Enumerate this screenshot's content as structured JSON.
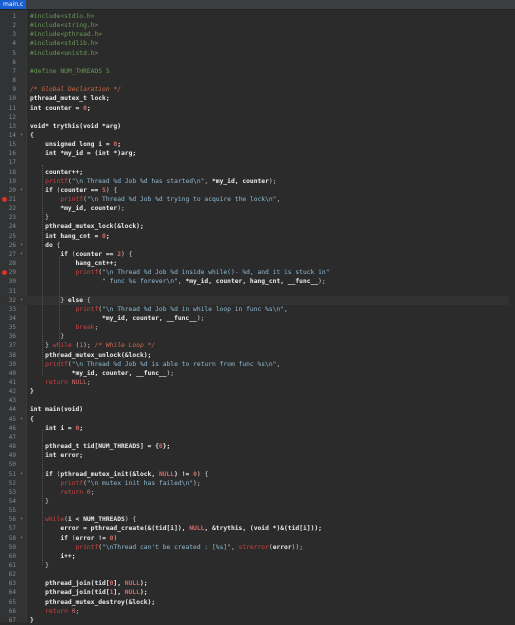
{
  "window": {
    "tab_label": "main.c"
  },
  "colors": {
    "background": "#2b2b2b",
    "gutter": "#313335",
    "tab_active": "#1a5fd1",
    "preprocessor": "#6a9955",
    "comment": "#cf6a4c",
    "string": "#8fbcd4",
    "function_call": "#d04040",
    "breakpoint": "#d9342b"
  },
  "editor": {
    "lines": [
      {
        "n": "1",
        "html": "<span class='pp'>#include&lt;stdio.h&gt;</span>"
      },
      {
        "n": "2",
        "html": "<span class='pp'>#include&lt;string.h&gt;</span>"
      },
      {
        "n": "3",
        "html": "<span class='pp'>#include&lt;pthread.h&gt;</span>"
      },
      {
        "n": "4",
        "html": "<span class='pp'>#include&lt;stdlib.h&gt;</span>"
      },
      {
        "n": "5",
        "html": "<span class='pp'>#include&lt;unistd.h&gt;</span>"
      },
      {
        "n": "6",
        "html": ""
      },
      {
        "n": "7",
        "html": "<span class='pp'>#define NUM_THREADS 5</span>"
      },
      {
        "n": "8",
        "html": ""
      },
      {
        "n": "9",
        "html": "<span class='cm'>/* Global Declaration */</span>"
      },
      {
        "n": "10",
        "html": "<span class='id'>pthread_mutex_t lock;</span>"
      },
      {
        "n": "11",
        "html": "<span class='id'>int counter = <span class='num'>0</span>;</span>"
      },
      {
        "n": "12",
        "html": ""
      },
      {
        "n": "13",
        "html": "<span class='id'>void* trythis(void *arg)</span>"
      },
      {
        "n": "14",
        "html": "<span class='id'>{</span>",
        "fold": "▾"
      },
      {
        "n": "15",
        "html": "    <span class='id'>unsigned long i = <span class='num'>0</span>;</span>"
      },
      {
        "n": "16",
        "html": "    <span class='id'>int *my_id = (int *)arg;</span>"
      },
      {
        "n": "17",
        "html": ""
      },
      {
        "n": "18",
        "html": "    <span class='id'>counter++;</span>"
      },
      {
        "n": "19",
        "html": "    <span class='fn'>printf</span>(<span class='str'>\"\\n Thread %d Job %d has started\\n\"</span>, <span class='id'>*my_id, counter</span>);"
      },
      {
        "n": "20",
        "html": "    <span class='kw'>if</span> (<span class='id'>counter == <span class='num'>5</span></span>) {",
        "fold": "▾"
      },
      {
        "n": "21",
        "html": "        <span class='fn'>printf</span>(<span class='str'>\"\\n Thread %d Job %d trying to acquire the lock\\n\"</span>,",
        "bp": true
      },
      {
        "n": "22",
        "html": "        <span class='id'>*my_id, counter</span>);"
      },
      {
        "n": "23",
        "html": "    }"
      },
      {
        "n": "24",
        "html": "    <span class='id'>pthread_mutex_lock(&amp;lock);</span>"
      },
      {
        "n": "25",
        "html": "    <span class='id'>int hang_cnt = <span class='num'>0</span>;</span>"
      },
      {
        "n": "26",
        "html": "    <span class='kw'>do</span> {",
        "fold": "▾"
      },
      {
        "n": "27",
        "html": "        <span class='kw'>if</span> (<span class='id'>counter == <span class='num'>2</span></span>) {",
        "fold": "▾"
      },
      {
        "n": "28",
        "html": "            <span class='id'>hang_cnt++;</span>"
      },
      {
        "n": "29",
        "html": "            <span class='fn'>printf</span>(<span class='str'>\"\\n Thread %d Job %d inside while()- %d, and it is stuck in\"</span>",
        "bp": true
      },
      {
        "n": "30",
        "html": "                   <span class='str'>\" func %s forever\\n\"</span>, <span class='id'>*my_id, counter, hang_cnt, __func__</span>);"
      },
      {
        "n": "31",
        "html": ""
      },
      {
        "n": "32",
        "html": "        } <span class='kw'>else</span> {",
        "fold": "▾",
        "cursor": true
      },
      {
        "n": "33",
        "html": "            <span class='fn'>printf</span>(<span class='str'>\"\\n Thread %d Job %d in while loop in func %s\\n\"</span>,"
      },
      {
        "n": "34",
        "html": "                   <span class='id'>*my_id, counter, __func__</span>);"
      },
      {
        "n": "35",
        "html": "            <span class='fn'>break</span>;"
      },
      {
        "n": "36",
        "html": "        }"
      },
      {
        "n": "37",
        "html": "    } <span class='fn'>while</span> (<span class='num'>1</span>); <span class='cm'>/* While Loop */</span>"
      },
      {
        "n": "38",
        "html": "    <span class='id'>pthread_mutex_unlock(&amp;lock);</span>"
      },
      {
        "n": "39",
        "html": "    <span class='fn'>printf</span>(<span class='str'>\"\\n Thread %d Job %d is able to return from func %s\\n\"</span>,"
      },
      {
        "n": "40",
        "html": "           <span class='id'>*my_id, counter, __func__</span>);"
      },
      {
        "n": "41",
        "html": "    <span class='fn'>return</span> <span class='num'>NULL</span>;"
      },
      {
        "n": "42",
        "html": "<span class='id'>}</span>"
      },
      {
        "n": "43",
        "html": ""
      },
      {
        "n": "44",
        "html": "<span class='id'>int main(void)</span>"
      },
      {
        "n": "45",
        "html": "<span class='id'>{</span>",
        "fold": "▾"
      },
      {
        "n": "46",
        "html": "    <span class='id'>int i = <span class='num'>0</span>;</span>"
      },
      {
        "n": "47",
        "html": ""
      },
      {
        "n": "48",
        "html": "    <span class='id'>pthread_t tid[NUM_THREADS] = {<span class='num'>0</span>};</span>"
      },
      {
        "n": "49",
        "html": "    <span class='id'>int error;</span>"
      },
      {
        "n": "50",
        "html": ""
      },
      {
        "n": "51",
        "html": "    <span class='kw'>if</span> (<span class='id'>pthread_mutex_init(&amp;lock, <span class='num'>NULL</span>) != <span class='num'>0</span></span>) {",
        "fold": "▾"
      },
      {
        "n": "52",
        "html": "        <span class='fn'>printf</span>(<span class='str'>\"\\n mutex init has failed\\n\"</span>);"
      },
      {
        "n": "53",
        "html": "        <span class='fn'>return</span> <span class='num'>0</span>;"
      },
      {
        "n": "54",
        "html": "    }"
      },
      {
        "n": "55",
        "html": ""
      },
      {
        "n": "56",
        "html": "    <span class='fn'>while</span>(<span class='id'>i &lt; NUM_THREADS</span>) {",
        "fold": "▾"
      },
      {
        "n": "57",
        "html": "        <span class='id'>error = pthread_create(&amp;(tid[i]), <span class='num'>NULL</span>, &amp;trythis, (void *)&amp;(tid[i]));</span>"
      },
      {
        "n": "58",
        "html": "        <span class='kw'>if</span> (<span class='id'>error != <span class='num'>0</span></span>)",
        "fold": "▾"
      },
      {
        "n": "59",
        "html": "            <span class='fn'>printf</span>(<span class='str'>\"\\nThread can't be created : [%s]\"</span>, <span class='fn'>strerror</span>(<span class='id'>error</span>));"
      },
      {
        "n": "60",
        "html": "        <span class='id'>i++;</span>"
      },
      {
        "n": "61",
        "html": "    }"
      },
      {
        "n": "62",
        "html": ""
      },
      {
        "n": "63",
        "html": "    <span class='id'>pthread_join(tid[<span class='num'>0</span>], <span class='num'>NULL</span>);</span>"
      },
      {
        "n": "64",
        "html": "    <span class='id'>pthread_join(tid[<span class='num'>1</span>], <span class='num'>NULL</span>);</span>"
      },
      {
        "n": "65",
        "html": "    <span class='id'>pthread_mutex_destroy(&amp;lock);</span>"
      },
      {
        "n": "66",
        "html": "    <span class='fn'>return</span> <span class='num'>0</span>;"
      },
      {
        "n": "67",
        "html": "<span class='id'>}</span>"
      }
    ]
  }
}
